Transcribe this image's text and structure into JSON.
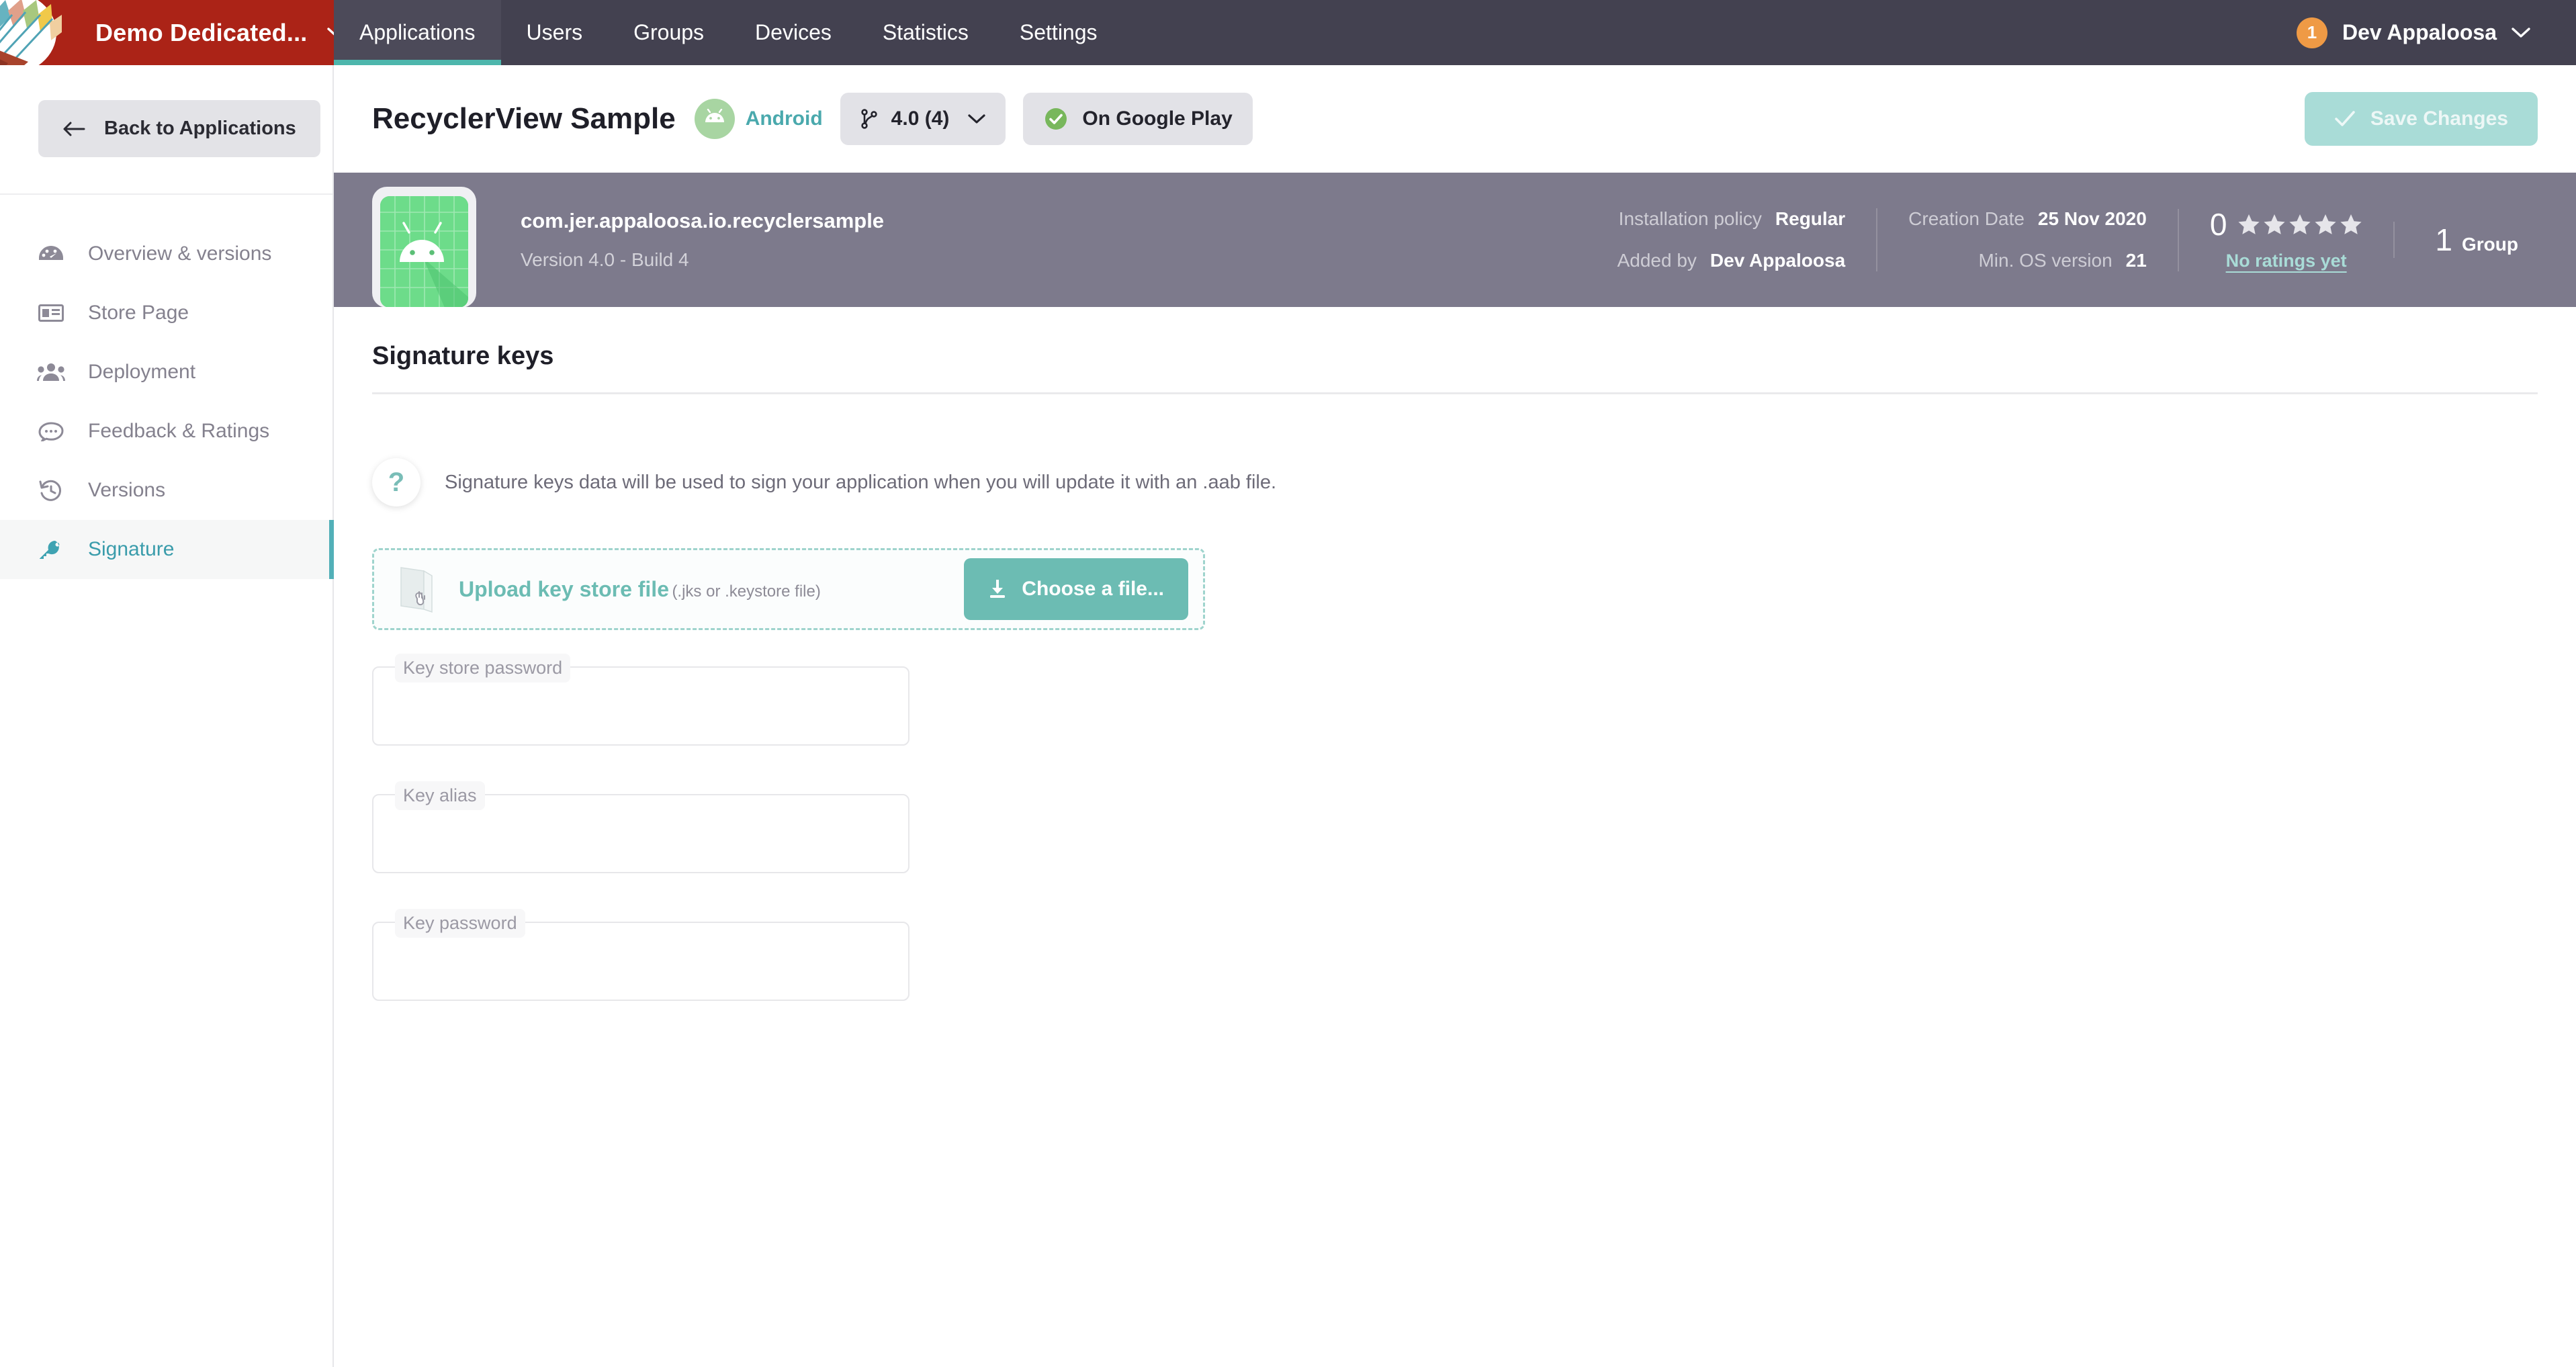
{
  "topbar": {
    "logo_icon": "appaloosa-arrows-logo",
    "org_name": "Demo Dedicated...",
    "org_chevron_icon": "chevron-down-icon",
    "nav": [
      {
        "label": "Applications",
        "active": true
      },
      {
        "label": "Users",
        "active": false
      },
      {
        "label": "Groups",
        "active": false
      },
      {
        "label": "Devices",
        "active": false
      },
      {
        "label": "Statistics",
        "active": false
      },
      {
        "label": "Settings",
        "active": false
      }
    ],
    "notification_count": "1",
    "user_name": "Dev Appaloosa",
    "user_chevron_icon": "chevron-down-icon"
  },
  "sidebar": {
    "back_label": "Back to Applications",
    "back_icon": "arrow-left-icon",
    "items": [
      {
        "label": "Overview & versions",
        "icon": "dashboard-icon",
        "active": false
      },
      {
        "label": "Store Page",
        "icon": "newspaper-icon",
        "active": false
      },
      {
        "label": "Deployment",
        "icon": "users-icon",
        "active": false
      },
      {
        "label": "Feedback & Ratings",
        "icon": "comment-icon",
        "active": false
      },
      {
        "label": "Versions",
        "icon": "history-icon",
        "active": false
      },
      {
        "label": "Signature",
        "icon": "key-icon",
        "active": true
      }
    ]
  },
  "page_header": {
    "app_title": "RecyclerView Sample",
    "os_icon": "android-icon",
    "os_label": "Android",
    "version_icon": "git-branch-icon",
    "version_label": "4.0 (4)",
    "version_chevron_icon": "chevron-down-icon",
    "store_icon": "check-circle-icon",
    "store_label": "On Google Play",
    "save_icon": "check-icon",
    "save_label": "Save Changes"
  },
  "info_bar": {
    "app_icon": "android-app-icon",
    "package_name": "com.jer.appaloosa.io.recyclersample",
    "version_line": "Version 4.0 - Build 4",
    "meta": [
      {
        "key": "Installation policy",
        "value": "Regular"
      },
      {
        "key": "Added by",
        "value": "Dev Appaloosa"
      },
      {
        "key": "Creation Date",
        "value": "25 Nov 2020"
      },
      {
        "key": "Min. OS version",
        "value": "21"
      }
    ],
    "rating_value": "0",
    "rating_stars": 5,
    "rating_link": "No ratings yet",
    "group_count": "1",
    "group_label": "Group"
  },
  "main": {
    "section_title": "Signature keys",
    "help_icon": "question-mark-icon",
    "help_text": "Signature keys data will be used to sign your application when you will update it with an .aab file.",
    "upload": {
      "file_icon": "file-upload-icon",
      "label": "Upload key store file",
      "hint": "(.jks or .keystore file)",
      "button_icon": "download-icon",
      "button_label": "Choose a file..."
    },
    "fields": [
      {
        "label": "Key store password",
        "value": "",
        "placeholder": ""
      },
      {
        "label": "Key alias",
        "value": "",
        "placeholder": ""
      },
      {
        "label": "Key password",
        "value": "",
        "placeholder": ""
      }
    ]
  },
  "colors": {
    "brand_red": "#ab2317",
    "topbar_dark": "#434150",
    "accent_teal": "#4db6ac",
    "active_teal": "#52b0b8",
    "info_bar_gray": "#7d7a8c",
    "badge_orange": "#ef9a45",
    "android_green": "#6ddc8a"
  }
}
